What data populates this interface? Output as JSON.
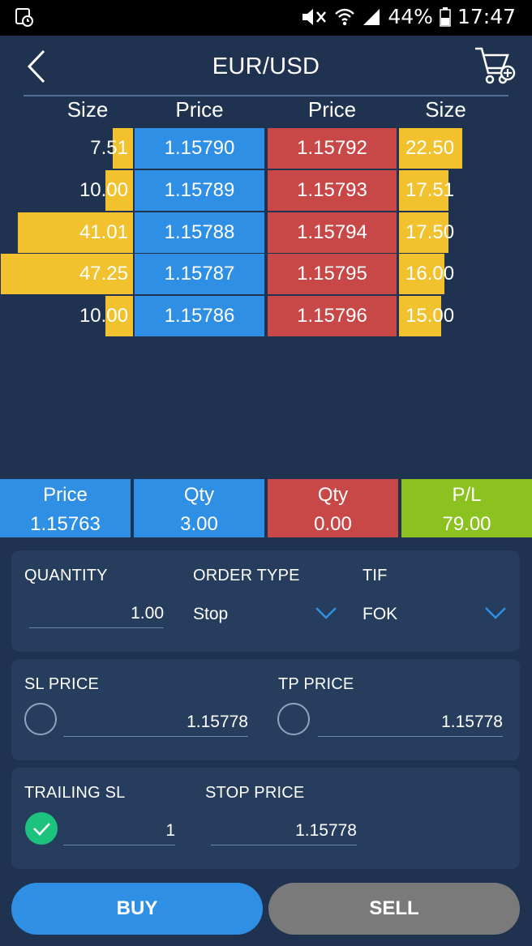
{
  "status_bar": {
    "battery": "44%",
    "time": "17:47"
  },
  "header": {
    "title": "EUR/USD"
  },
  "depth": {
    "headers": {
      "bid_size": "Size",
      "bid_price": "Price",
      "ask_price": "Price",
      "ask_size": "Size"
    },
    "rows": [
      {
        "bid_size": "7.51",
        "bid_price": "1.15790",
        "ask_price": "1.15792",
        "ask_size": "22.50"
      },
      {
        "bid_size": "10.00",
        "bid_price": "1.15789",
        "ask_price": "1.15793",
        "ask_size": "17.51"
      },
      {
        "bid_size": "41.01",
        "bid_price": "1.15788",
        "ask_price": "1.15794",
        "ask_size": "17.50"
      },
      {
        "bid_size": "47.25",
        "bid_price": "1.15787",
        "ask_price": "1.15795",
        "ask_size": "16.00"
      },
      {
        "bid_size": "10.00",
        "bid_price": "1.15786",
        "ask_price": "1.15796",
        "ask_size": "15.00"
      }
    ]
  },
  "summary": [
    {
      "label": "Price",
      "value": "1.15763",
      "color": "#2f8fe5"
    },
    {
      "label": "Qty",
      "value": "3.00",
      "color": "#2f8fe5"
    },
    {
      "label": "Qty",
      "value": "0.00",
      "color": "#c84848"
    },
    {
      "label": "P/L",
      "value": "79.00",
      "color": "#8cc21f"
    }
  ],
  "order": {
    "quantity_label": "QUANTITY",
    "quantity_value": "1.00",
    "order_type_label": "ORDER TYPE",
    "order_type_value": "Stop",
    "tif_label": "TIF",
    "tif_value": "FOK"
  },
  "sl_tp": {
    "sl_label": "SL PRICE",
    "sl_value": "1.15778",
    "tp_label": "TP PRICE",
    "tp_value": "1.15778"
  },
  "trailing": {
    "trailing_label": "TRAILING SL",
    "trailing_value": "1",
    "stop_label": "STOP PRICE",
    "stop_value": "1.15778"
  },
  "actions": {
    "buy_label": "BUY",
    "sell_label": "SELL"
  },
  "colors": {
    "background": "#1f3350",
    "bid": "#2f8fe5",
    "ask": "#c84848",
    "size_bar": "#f2c12e",
    "profit": "#8cc21f",
    "check": "#1ec27f"
  }
}
